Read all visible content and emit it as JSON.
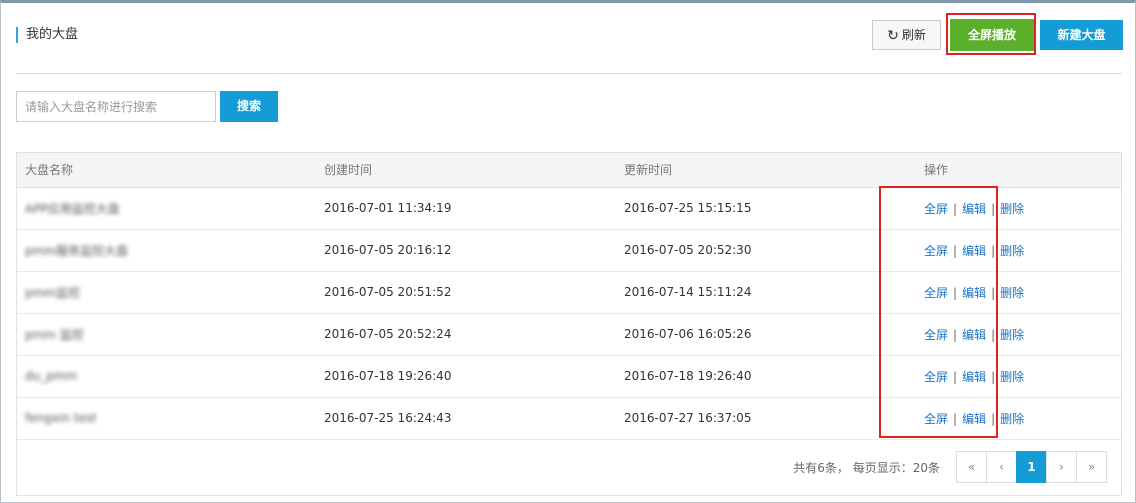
{
  "header": {
    "title": "我的大盘",
    "refresh_label": "刷新",
    "fullscreen_label": "全屏播放",
    "new_label": "新建大盘"
  },
  "search": {
    "placeholder": "请输入大盘名称进行搜索",
    "value": "",
    "button_label": "搜索"
  },
  "table": {
    "columns": [
      "大盘名称",
      "创建时间",
      "更新时间",
      "操作"
    ],
    "rows": [
      {
        "name": "APP应用监控大盘",
        "created": "2016-07-01 11:34:19",
        "updated": "2016-07-25 15:15:15"
      },
      {
        "name": "pmm服务监控大盘",
        "created": "2016-07-05 20:16:12",
        "updated": "2016-07-05 20:52:30"
      },
      {
        "name": "pmm监控",
        "created": "2016-07-05 20:51:52",
        "updated": "2016-07-14 15:11:24"
      },
      {
        "name": "pmm 监控",
        "created": "2016-07-05 20:52:24",
        "updated": "2016-07-06 16:05:26"
      },
      {
        "name": "du_pmm",
        "created": "2016-07-18 19:26:40",
        "updated": "2016-07-18 19:26:40"
      },
      {
        "name": "fengxin test",
        "created": "2016-07-25 16:24:43",
        "updated": "2016-07-27 16:37:05"
      }
    ],
    "actions": {
      "fullscreen": "全屏",
      "edit": "编辑",
      "delete": "删除",
      "separator": "|"
    }
  },
  "pagination": {
    "summary": "共有6条， 每页显示：20条",
    "first": "«",
    "prev": "‹",
    "current_page": "1",
    "next": "›",
    "last": "»"
  },
  "icons": {
    "refresh": "refresh-icon"
  },
  "colors": {
    "primary_blue": "#139cd6",
    "green": "#5ab02a",
    "link": "#1a73c8",
    "highlight_red": "#dd2222"
  }
}
